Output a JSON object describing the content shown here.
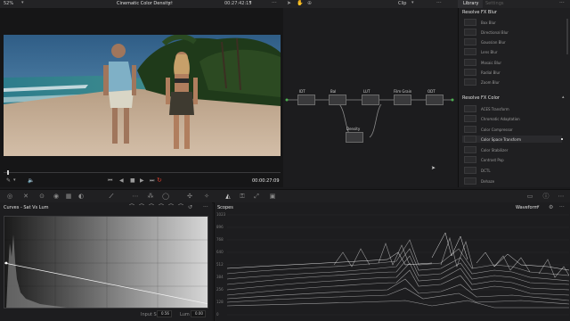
{
  "topbar": {
    "zoom": "52%",
    "project_title": "Cinematic Color Density",
    "timecode": "00:27:42:15",
    "clip_label": "Clip",
    "library_tab": "Library",
    "settings_tab": "Settings"
  },
  "viewer": {
    "current_timecode": "00:00:27:09"
  },
  "node_graph": {
    "nodes": [
      {
        "label": "IDT"
      },
      {
        "label": "Bal"
      },
      {
        "label": "LUT"
      },
      {
        "label": "Film Grain"
      },
      {
        "label": "ODT"
      },
      {
        "label": "Density"
      }
    ]
  },
  "library": {
    "sections": [
      {
        "title": "Resolve FX Blur",
        "items": [
          "Box Blur",
          "Directional Blur",
          "Gaussian Blur",
          "Lens Blur",
          "Mosaic Blur",
          "Radial Blur",
          "Zoom Blur"
        ]
      },
      {
        "title": "Resolve FX Color",
        "items": [
          "ACES Transform",
          "Chromatic Adaptation",
          "Color Compressor",
          "Color Space Transform",
          "Color Stabilizer",
          "Contrast Pop",
          "DCTL",
          "Dehaze"
        ]
      }
    ]
  },
  "curves": {
    "title": "Curves - Sat Vs Lum",
    "input_label": "Input Sat",
    "input_value": "0.56",
    "lum_label": "Lum",
    "lum_value": "0.00"
  },
  "scopes": {
    "title": "Scopes",
    "mode": "Waveform",
    "scale": [
      "1023",
      "896",
      "768",
      "640",
      "512",
      "384",
      "256",
      "128",
      "0"
    ]
  },
  "colors": {
    "accent": "#e8b04a",
    "record": "#d9412f",
    "background": "#1b1b1d"
  }
}
